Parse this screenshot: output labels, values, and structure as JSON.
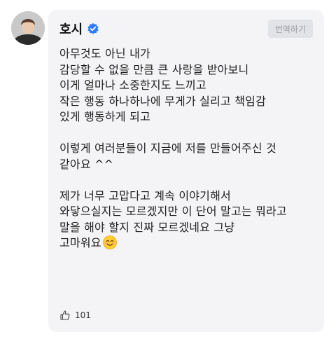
{
  "author": {
    "name": "호시",
    "avatar_icon": "avatar-photo",
    "verified_icon": "verified-badge-icon",
    "verified_color": "#2f7cf6"
  },
  "translate_button": "번역하기",
  "post": {
    "lines": [
      "아무것도 아닌 내가",
      "감당할 수 없을 만큼 큰 사랑을 받아보니",
      "이게 얼마나 소중한지도 느끼고",
      "작은 행동 하나하나에 무게가 실리고 책임감",
      "있게 행동하게 되고",
      "",
      "이렇게 여러분들이 지금에 저를 만들어주신 것",
      "같아요 ^^",
      "",
      "제가 너무 고맙다고 계속 이야기해서",
      "와닿으실지는 모르겠지만 이 단어 말고는 뭐라고",
      "말을 해야 할지 진짜 모르겠네요 그냥",
      "고마워요"
    ],
    "emoji_icon": "smiling-face-emoji-icon"
  },
  "likes": {
    "icon": "thumbs-up-icon",
    "count": "101"
  }
}
